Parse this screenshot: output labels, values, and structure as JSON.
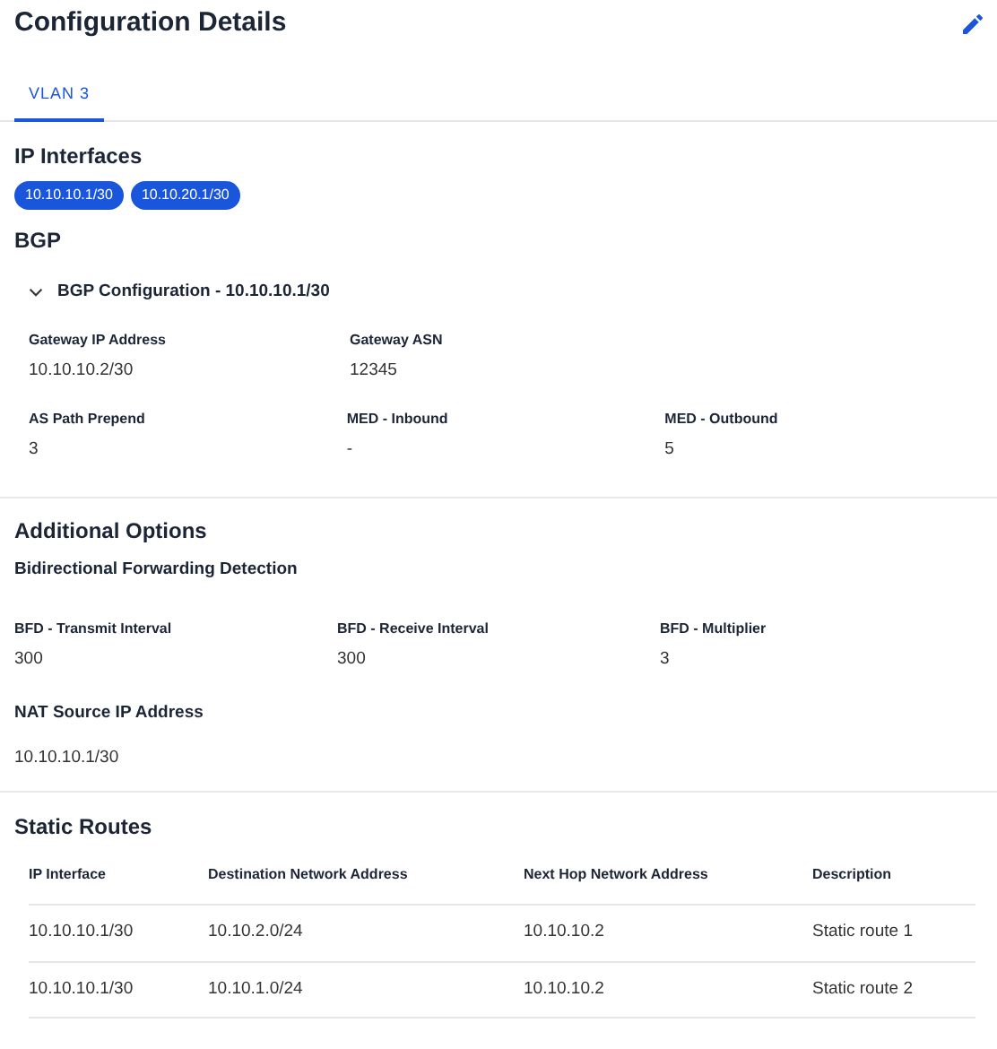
{
  "header": {
    "title": "Configuration Details"
  },
  "tabs": [
    {
      "label": "VLAN 3",
      "selected": true
    }
  ],
  "ip_interfaces": {
    "title": "IP Interfaces",
    "chips": [
      "10.10.10.1/30",
      "10.10.20.1/30"
    ]
  },
  "bgp": {
    "title": "BGP",
    "panels": [
      {
        "title": "BGP Configuration - 10.10.10.1/30",
        "expanded": true,
        "rows": [
          [
            {
              "label": "Gateway IP Address",
              "value": "10.10.10.2/30"
            },
            {
              "label": "Gateway ASN",
              "value": "12345"
            }
          ],
          [
            {
              "label": "AS Path Prepend",
              "value": "3"
            },
            {
              "label": "MED - Inbound",
              "value": "-"
            },
            {
              "label": "MED - Outbound",
              "value": "5"
            }
          ]
        ]
      }
    ]
  },
  "additional_options": {
    "title": "Additional Options",
    "bfd": {
      "title": "Bidirectional Forwarding Detection",
      "fields": [
        {
          "label": "BFD - Transmit Interval",
          "value": "300"
        },
        {
          "label": "BFD - Receive Interval",
          "value": "300"
        },
        {
          "label": "BFD - Multiplier",
          "value": "3"
        }
      ]
    },
    "nat": {
      "label": "NAT Source IP Address",
      "value": "10.10.10.1/30"
    }
  },
  "static_routes": {
    "title": "Static Routes",
    "columns": [
      "IP Interface",
      "Destination Network Address",
      "Next Hop Network Address",
      "Description"
    ],
    "rows": [
      [
        "10.10.10.1/30",
        "10.10.2.0/24",
        "10.10.10.2",
        "Static route 1"
      ],
      [
        "10.10.10.1/30",
        "10.10.1.0/24",
        "10.10.10.2",
        "Static route 2"
      ]
    ]
  }
}
